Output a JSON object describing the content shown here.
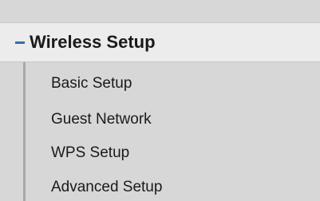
{
  "menu": {
    "section": {
      "label": "Wireless Setup",
      "icon": "collapse-minus-icon",
      "expanded": true
    },
    "items": [
      {
        "label": "Basic Setup"
      },
      {
        "label": "Guest Network"
      },
      {
        "label": "WPS Setup"
      },
      {
        "label": "Advanced Setup"
      }
    ],
    "colors": {
      "background": "#d7d7d7",
      "header_background": "#ececec",
      "accent": "#3a6aa8",
      "text": "#1a1a1a"
    }
  }
}
